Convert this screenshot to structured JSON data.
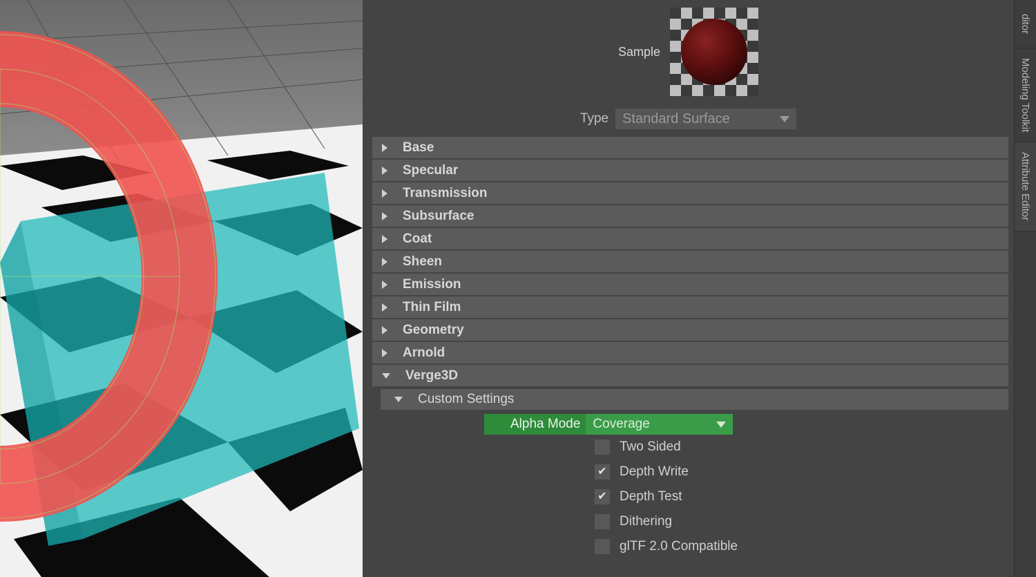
{
  "sample_label": "Sample",
  "type_label": "Type",
  "type_value": "Standard Surface",
  "sections": {
    "s0": "Base",
    "s1": "Specular",
    "s2": "Transmission",
    "s3": "Subsurface",
    "s4": "Coat",
    "s5": "Sheen",
    "s6": "Emission",
    "s7": "Thin Film",
    "s8": "Geometry",
    "s9": "Arnold",
    "s10": "Verge3D"
  },
  "subsection": "Custom Settings",
  "alpha_mode_label": "Alpha Mode",
  "alpha_mode_value": "Coverage",
  "checks": {
    "c0": {
      "label": "Two Sided",
      "checked": false
    },
    "c1": {
      "label": "Depth Write",
      "checked": true
    },
    "c2": {
      "label": "Depth Test",
      "checked": true
    },
    "c3": {
      "label": "Dithering",
      "checked": false
    },
    "c4": {
      "label": "glTF 2.0 Compatible",
      "checked": false
    }
  },
  "tabs": {
    "t0": "ditor",
    "t1": "Modeling Toolkit",
    "t2": "Attribute Editor"
  },
  "colors": {
    "highlight": "#2e8b3a"
  }
}
